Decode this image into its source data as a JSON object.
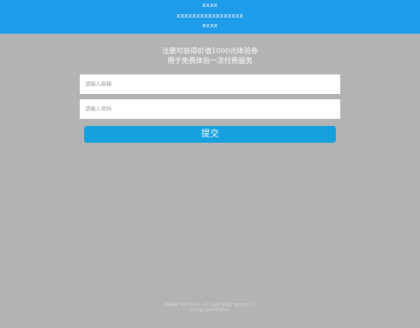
{
  "header": {
    "line1": "xxxx",
    "line2": "xxxxxxxxxxxxxxxxx",
    "line3": "xxxx"
  },
  "promo": {
    "line1": "注册可获得价值1000元体验券",
    "line2": "用于免费体验一次付费服务"
  },
  "form": {
    "email_placeholder": "请输入邮箱",
    "email_value": "",
    "password_placeholder": "请输入密码",
    "password_value": "",
    "submit_label": "提交"
  },
  "footer": {
    "line1": "版权所有 2014 Xxxxx 公司 上海市 黄浦区 南京东路 1 号",
    "line2": "沪ICP备 1234567890号"
  },
  "colors": {
    "header_bg": "#1e9be9",
    "page_bg": "#b3b3b3",
    "button_bg": "#15a0de"
  }
}
